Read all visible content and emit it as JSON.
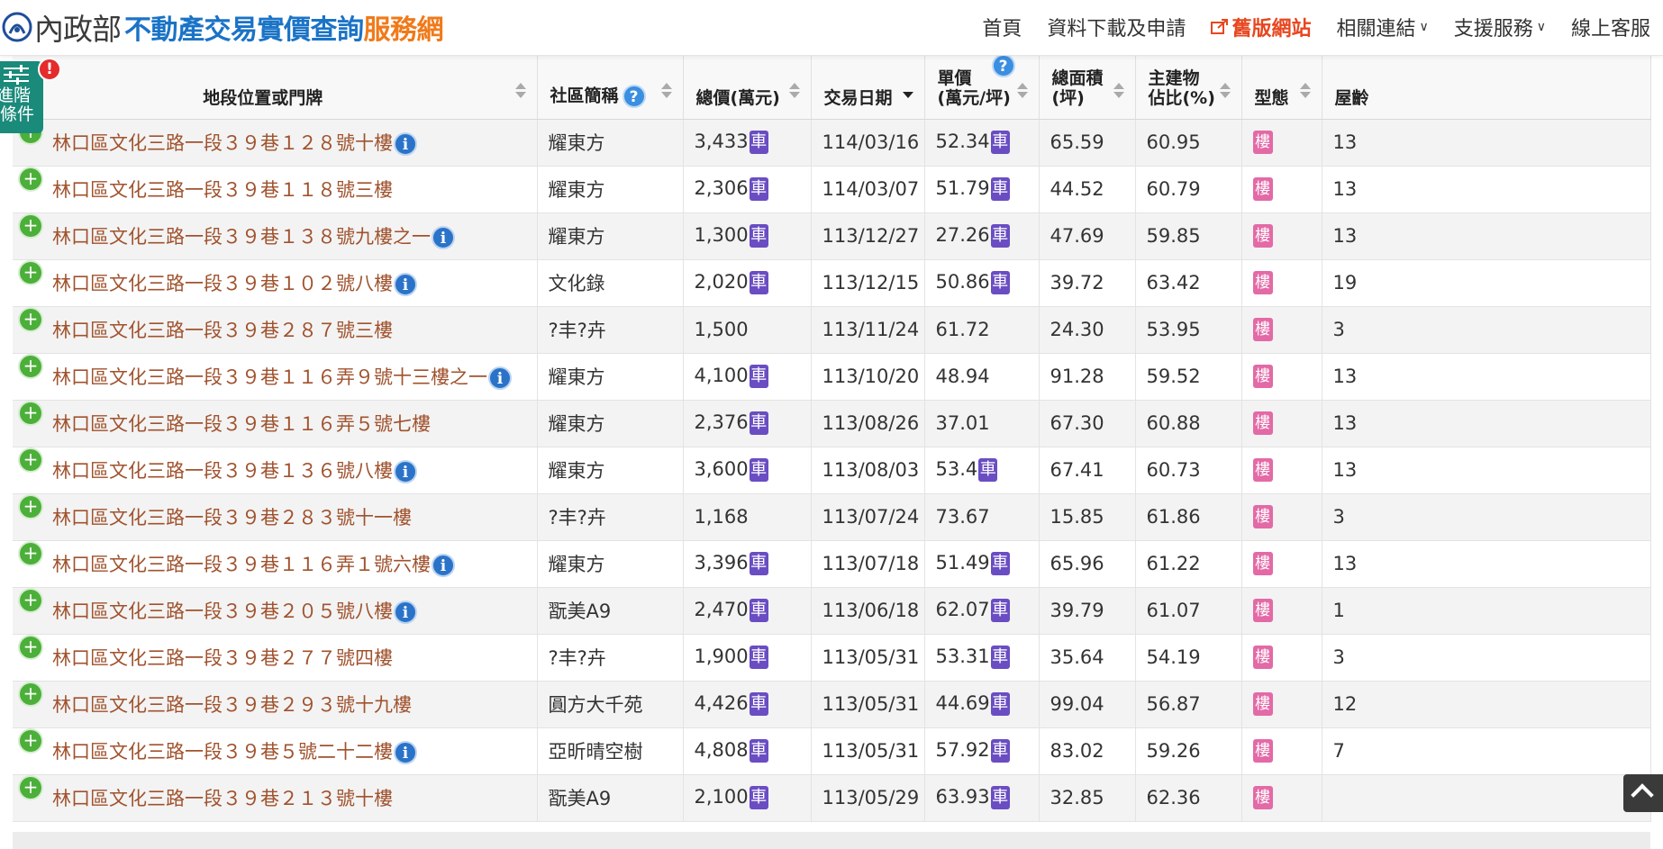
{
  "header": {
    "ministry": "內政部",
    "site_main": "不動產交易實價查詢",
    "site_accent": "服務網"
  },
  "nav": [
    {
      "label": "首頁",
      "dropdown": false,
      "style": "normal"
    },
    {
      "label": "資料下載及申請",
      "dropdown": false,
      "style": "normal"
    },
    {
      "label": "舊版網站",
      "dropdown": false,
      "style": "old"
    },
    {
      "label": "相關連結",
      "dropdown": true,
      "style": "normal"
    },
    {
      "label": "支援服務",
      "dropdown": true,
      "style": "normal"
    },
    {
      "label": "線上客服",
      "dropdown": false,
      "style": "normal"
    }
  ],
  "filter_tab": {
    "label": "進階條件",
    "alert": "!"
  },
  "table": {
    "columns": [
      {
        "label": "地段位置或門牌",
        "help": false
      },
      {
        "label": "社區簡稱",
        "help": true
      },
      {
        "label": "總價(萬元)",
        "help": false
      },
      {
        "label": "交易日期",
        "help": false,
        "sorted": "desc"
      },
      {
        "label": "單價",
        "label2": "(萬元/坪)",
        "help": true
      },
      {
        "label": "總面積",
        "label2": "(坪)",
        "help": false
      },
      {
        "label": "主建物",
        "label2": "佔比(%)",
        "help": false
      },
      {
        "label": "型態",
        "help": false
      },
      {
        "label": "屋齡",
        "help": false
      }
    ],
    "badges": {
      "car": "車",
      "type": "樓",
      "plus": "+",
      "info": "i"
    },
    "rows": [
      {
        "address": "林口區文化三路一段３９巷１２８號十樓",
        "info": true,
        "community": "耀東方",
        "total": "3,433",
        "total_car": true,
        "date": "114/03/16",
        "unit": "52.34",
        "unit_car": true,
        "area": "65.59",
        "ratio": "60.95",
        "age": "13"
      },
      {
        "address": "林口區文化三路一段３９巷１１８號三樓",
        "info": false,
        "community": "耀東方",
        "total": "2,306",
        "total_car": true,
        "date": "114/03/07",
        "unit": "51.79",
        "unit_car": true,
        "area": "44.52",
        "ratio": "60.79",
        "age": "13"
      },
      {
        "address": "林口區文化三路一段３９巷１３８號九樓之一",
        "info": true,
        "community": "耀東方",
        "total": "1,300",
        "total_car": true,
        "date": "113/12/27",
        "unit": "27.26",
        "unit_car": true,
        "area": "47.69",
        "ratio": "59.85",
        "age": "13"
      },
      {
        "address": "林口區文化三路一段３９巷１０２號八樓",
        "info": true,
        "community": "文化錄",
        "total": "2,020",
        "total_car": true,
        "date": "113/12/15",
        "unit": "50.86",
        "unit_car": true,
        "area": "39.72",
        "ratio": "63.42",
        "age": "19"
      },
      {
        "address": "林口區文化三路一段３９巷２８７號三樓",
        "info": false,
        "community": "?丰?卉",
        "total": "1,500",
        "total_car": false,
        "date": "113/11/24",
        "unit": "61.72",
        "unit_car": false,
        "area": "24.30",
        "ratio": "53.95",
        "age": "3"
      },
      {
        "address": "林口區文化三路一段３９巷１１６弄９號十三樓之一",
        "info": true,
        "community": "耀東方",
        "total": "4,100",
        "total_car": true,
        "date": "113/10/20",
        "unit": "48.94",
        "unit_car": false,
        "area": "91.28",
        "ratio": "59.52",
        "age": "13"
      },
      {
        "address": "林口區文化三路一段３９巷１１６弄５號七樓",
        "info": false,
        "community": "耀東方",
        "total": "2,376",
        "total_car": true,
        "date": "113/08/26",
        "unit": "37.01",
        "unit_car": false,
        "area": "67.30",
        "ratio": "60.88",
        "age": "13"
      },
      {
        "address": "林口區文化三路一段３９巷１３６號八樓",
        "info": true,
        "community": "耀東方",
        "total": "3,600",
        "total_car": true,
        "date": "113/08/03",
        "unit": "53.4",
        "unit_car": true,
        "area": "67.41",
        "ratio": "60.73",
        "age": "13"
      },
      {
        "address": "林口區文化三路一段３９巷２８３號十一樓",
        "info": false,
        "community": "?丰?卉",
        "total": "1,168",
        "total_car": false,
        "date": "113/07/24",
        "unit": "73.67",
        "unit_car": false,
        "area": "15.85",
        "ratio": "61.86",
        "age": "3"
      },
      {
        "address": "林口區文化三路一段３９巷１１６弄１號六樓",
        "info": true,
        "community": "耀東方",
        "total": "3,396",
        "total_car": true,
        "date": "113/07/18",
        "unit": "51.49",
        "unit_car": true,
        "area": "65.96",
        "ratio": "61.22",
        "age": "13"
      },
      {
        "address": "林口區文化三路一段３９巷２０５號八樓",
        "info": true,
        "community": "翫美A9",
        "total": "2,470",
        "total_car": true,
        "date": "113/06/18",
        "unit": "62.07",
        "unit_car": true,
        "area": "39.79",
        "ratio": "61.07",
        "age": "1"
      },
      {
        "address": "林口區文化三路一段３９巷２７７號四樓",
        "info": false,
        "community": "?丰?卉",
        "total": "1,900",
        "total_car": true,
        "date": "113/05/31",
        "unit": "53.31",
        "unit_car": true,
        "area": "35.64",
        "ratio": "54.19",
        "age": "3"
      },
      {
        "address": "林口區文化三路一段３９巷２９３號十九樓",
        "info": false,
        "community": "圓方大千苑",
        "total": "4,426",
        "total_car": true,
        "date": "113/05/31",
        "unit": "44.69",
        "unit_car": true,
        "area": "99.04",
        "ratio": "56.87",
        "age": "12"
      },
      {
        "address": "林口區文化三路一段３９巷５號二十二樓",
        "info": true,
        "community": "亞昕晴空樹",
        "total": "4,808",
        "total_car": true,
        "date": "113/05/31",
        "unit": "57.92",
        "unit_car": true,
        "area": "83.02",
        "ratio": "59.26",
        "age": "7"
      },
      {
        "address": "林口區文化三路一段３９巷２１３號十樓",
        "info": false,
        "community": "翫美A9",
        "total": "2,100",
        "total_car": true,
        "date": "113/05/29",
        "unit": "63.93",
        "unit_car": true,
        "area": "32.85",
        "ratio": "62.36",
        "age": ""
      }
    ]
  },
  "colors": {
    "brand": "#1a73c6",
    "accent": "#f07a1a",
    "old_site": "#e8461f",
    "address": "#a0522d",
    "car_badge": "#6a4dc2",
    "type_badge": "#e36aa6",
    "filter_tab": "#1a8a7a"
  }
}
